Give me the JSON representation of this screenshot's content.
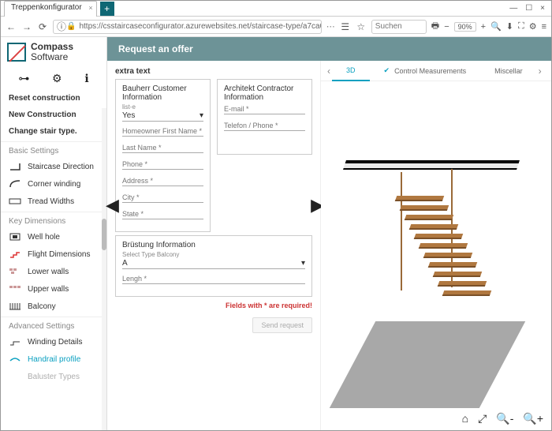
{
  "browser": {
    "tab_title": "Treppenkonfigurator",
    "url": "https://csstaircaseconfigurator.azurewebsites.net/staircase-type/a7ca037f-b96a-4d4e-9d59-e1e6e68...",
    "search_placeholder": "Suchen",
    "zoom": "90%"
  },
  "logo": {
    "line1": "Compass",
    "line2": "Software"
  },
  "sidebar": {
    "reset": "Reset construction",
    "new": "New Construction",
    "change": "Change stair type.",
    "sec_basic": "Basic Settings",
    "basic": [
      "Staircase Direction",
      "Corner winding",
      "Tread Widths"
    ],
    "sec_key": "Key Dimensions",
    "key": [
      "Well hole",
      "Flight Dimensions",
      "Lower walls",
      "Upper walls",
      "Balcony"
    ],
    "sec_adv": "Advanced Settings",
    "adv": [
      "Winding Details",
      "Handrail profile",
      "Baluster Types"
    ]
  },
  "header": {
    "title": "Request an offer"
  },
  "form": {
    "extra": "extra text",
    "cust_title": "Bauherr Customer Information",
    "list_lbl": "list-e",
    "list_val": "Yes",
    "fn": "Homeowner First Name *",
    "ln": "Last Name *",
    "ph": "Phone *",
    "addr": "Address *",
    "city": "City *",
    "state": "State *",
    "arch_title": "Architekt Contractor Information",
    "email": "E-mail *",
    "tel": "Telefon / Phone *",
    "bal_title": "Brüstung Information",
    "bal_lbl": "Select Type Balcony",
    "bal_val": "A",
    "len": "Lengh *",
    "req": "Fields with * are required!",
    "send": "Send request"
  },
  "tabs": {
    "t1": "3D",
    "t2": "Control Measurements",
    "t3": "Miscellar"
  }
}
